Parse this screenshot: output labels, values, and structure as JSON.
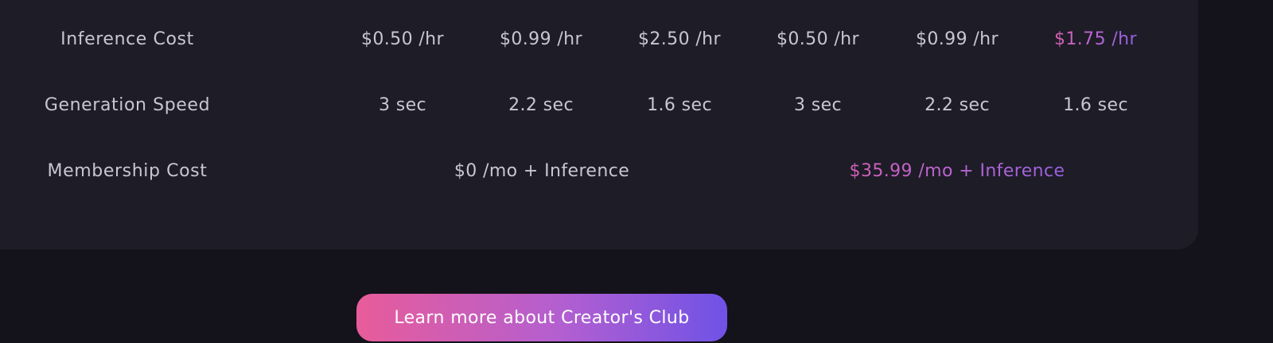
{
  "comparison_table": {
    "rows": [
      {
        "label": "Inference Cost",
        "cells": [
          "$0.50 /hr",
          "$0.99 /hr",
          "$2.50 /hr",
          "$0.50 /hr",
          "$0.99 /hr",
          "$1.75 /hr"
        ]
      },
      {
        "label": "Generation Speed",
        "cells": [
          "3 sec",
          "2.2 sec",
          "1.6 sec",
          "3 sec",
          "2.2 sec",
          "1.6 sec"
        ]
      },
      {
        "label": "Membership Cost",
        "cells": [
          "$0 /mo + Inference",
          "$35.99 /mo + Inference"
        ]
      }
    ]
  },
  "cta": {
    "label": "Learn more about Creator's Club"
  },
  "colors": {
    "page_background": "#14121a",
    "panel_background": "#1e1c27",
    "text": "#c8c6d0",
    "accent_gradient_start": "#e85c9a",
    "accent_gradient_end": "#6f52e6"
  }
}
